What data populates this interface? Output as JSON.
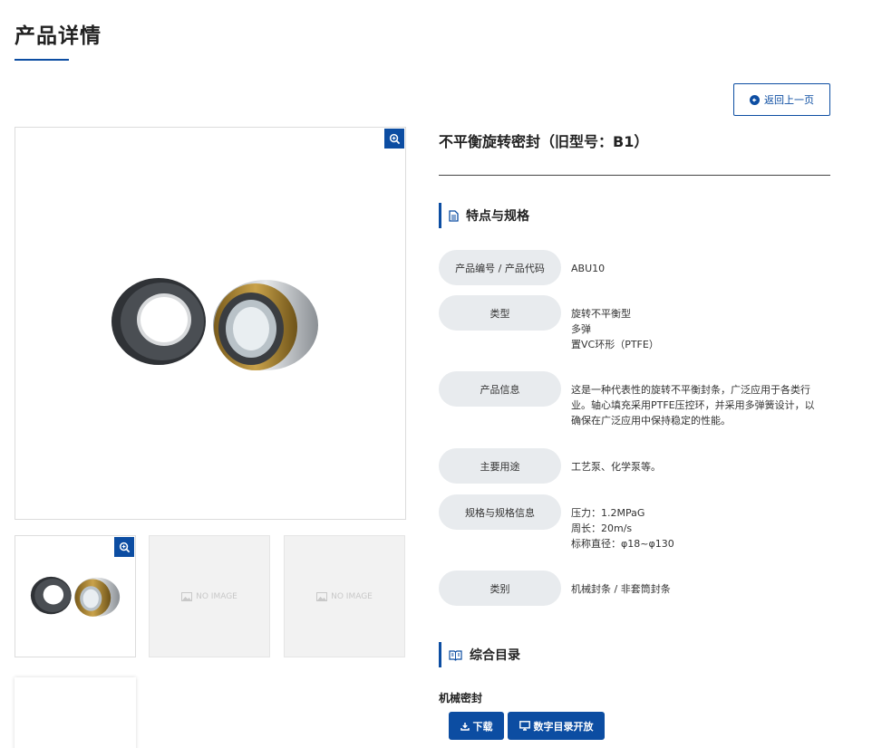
{
  "header": {
    "title": "产品详情"
  },
  "back_button": {
    "label": "返回上一页"
  },
  "gallery": {
    "placeholder_text": "NO IMAGE"
  },
  "product": {
    "name": "不平衡旋转密封（旧型号：B1）"
  },
  "spec_section": {
    "title": "特点与规格",
    "rows": [
      {
        "label": "产品编号 / 产品代码",
        "lines": [
          "ABU10"
        ]
      },
      {
        "label": "类型",
        "lines": [
          "旋转不平衡型",
          "多弹",
          "置VC环形（PTFE）"
        ]
      },
      {
        "label": "产品信息",
        "lines": [
          "这是一种代表性的旋转不平衡封条，广泛应用于各类行",
          "业。轴心填充采用PTFE压控环，并采用多弹簧设计，以",
          "确保在广泛应用中保持稳定的性能。"
        ]
      },
      {
        "label": "主要用途",
        "lines": [
          "工艺泵、化学泵等。"
        ]
      },
      {
        "label": "规格与规格信息",
        "lines": [
          "压力：1.2MPaG",
          "周长：20m/s",
          "标称直径：φ18~φ130"
        ]
      },
      {
        "label": "类别",
        "lines": [
          "机械封条 / 非套筒封条"
        ]
      }
    ]
  },
  "catalog_section": {
    "title": "综合目录",
    "item_label": "机械密封",
    "download_label": "下载",
    "digital_label": "数字目录开放"
  },
  "colors": {
    "accent": "#0c4da2",
    "label_bg": "#e8ebee"
  }
}
